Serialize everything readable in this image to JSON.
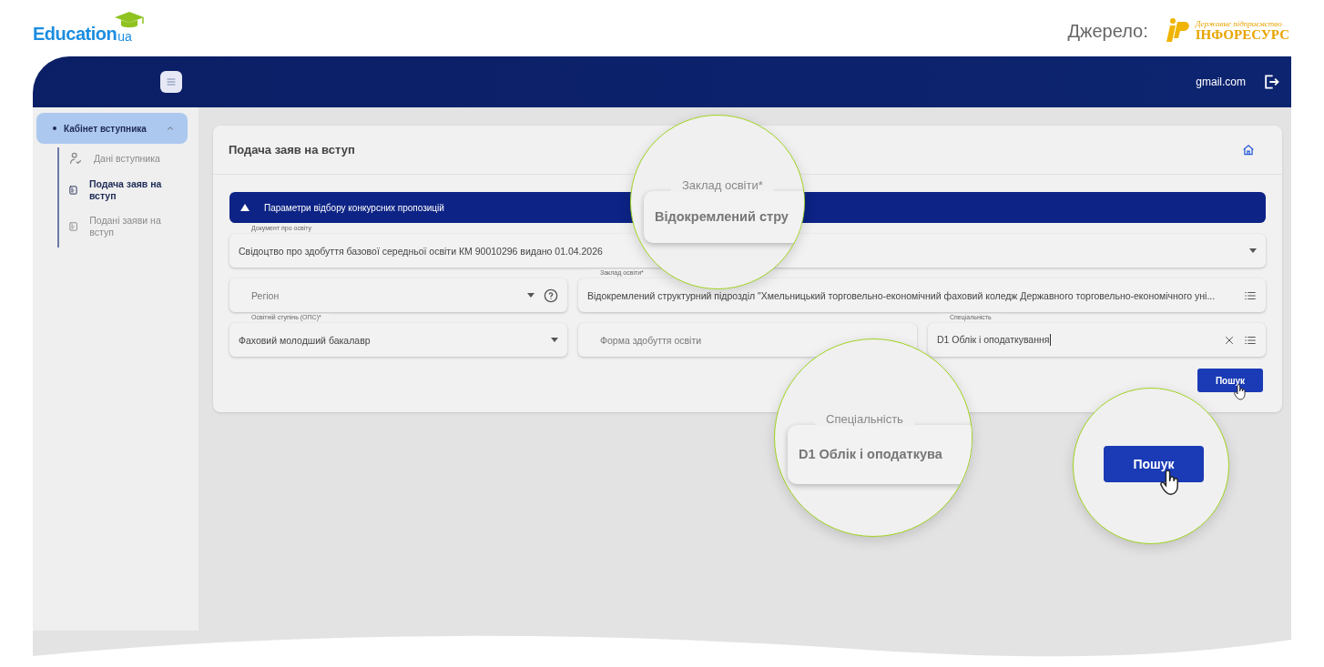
{
  "brand": {
    "name": "Education",
    "suffix": "ua"
  },
  "source": {
    "label": "Джерело:",
    "logo_caption": "Державне підприємство",
    "logo_name": "ІНФОРЕСУРС"
  },
  "header": {
    "email": "gmail.com"
  },
  "sidebar": {
    "group": {
      "label": "Кабінет вступника",
      "expanded": true,
      "children": [
        {
          "label": "Дані вступника",
          "selected": false,
          "kind": "person"
        },
        {
          "label": "Подача заяв на вступ",
          "selected": true,
          "kind": "doc"
        },
        {
          "label": "Подані заяви на вступ",
          "selected": false,
          "kind": "doc"
        }
      ]
    }
  },
  "card": {
    "title": "Подача заяв на вступ",
    "filter": {
      "title": "Параметри відбору конкурсних пропозицій",
      "expanded": true,
      "rows": [
        [
          {
            "kind": "select",
            "label": "Документ про освіту",
            "value": "Свідоцтво про здобуття базової середньої освіти КМ 90010296 видано 01.04.2026"
          }
        ],
        [
          {
            "kind": "select",
            "placeholder": "Регіон",
            "help": true
          },
          {
            "kind": "picker",
            "label": "Заклад освіти*",
            "value": "Відокремлений структурний підрозділ \"Хмельницький торговельно-економічний фаховий коледж Державного торговельно-економічного уні..."
          }
        ],
        [
          {
            "kind": "select",
            "label": "Освітній ступінь (ОПС)*",
            "value": "Фаховий молодший бакалавр"
          },
          {
            "kind": "text",
            "placeholder": "Форма здобуття освіти"
          },
          {
            "kind": "picker",
            "label": "Спеціальність",
            "value": "D1 Облік і оподаткування",
            "clearable": true,
            "focused": true
          }
        ]
      ]
    },
    "search_button": "Пошук"
  },
  "magnifiers": [
    {
      "kind": "field",
      "label": "Заклад освіти*",
      "value": "Відокремлений стру"
    },
    {
      "kind": "field",
      "label": "Спеціальність",
      "value": "D1 Облік і оподаткува"
    },
    {
      "kind": "button",
      "label": "Пошук"
    }
  ]
}
